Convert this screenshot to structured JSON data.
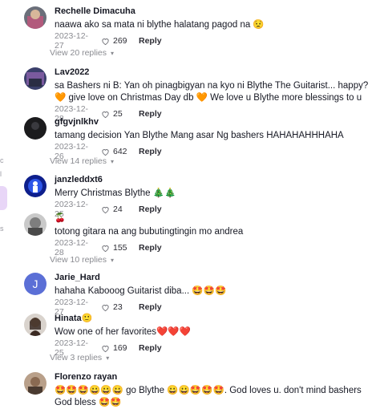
{
  "comments": [
    {
      "username": "Rechelle Dimacuha",
      "text": "naawa ako sa mata ni blythe halatang pagod na 😟",
      "date": "2023-12-27",
      "likes": "269",
      "reply": "Reply"
    },
    {
      "username": "Lav2022",
      "text": "sa Bashers ni B: Yan oh pinagbigyan na kyo ni Blythe The Guitarist... happy?🧡 give love on Christmas Day db 🧡 We love u Blythe more blessings to u",
      "date": "2023-12-28",
      "likes": "25",
      "reply": "Reply"
    },
    {
      "username": "gfgvjnlkhv",
      "text": "tamang decision Yan Blythe Mang asar Ng bashers HAHAHAHHHAHA",
      "date": "2023-12-26",
      "likes": "642",
      "reply": "Reply"
    },
    {
      "username": "janzleddxt6",
      "text": "Merry Christmas Blythe 🎄🎄",
      "date": "2023-12-25",
      "likes": "24",
      "reply": "Reply"
    },
    {
      "username": "🍒",
      "text": "totong gitara na ang bubutingtingin mo andrea",
      "date": "2023-12-28",
      "likes": "155",
      "reply": "Reply"
    },
    {
      "username": "Jarie_Hard",
      "avatar_letter": "J",
      "text": "hahaha Kabooog Guitarist diba... 🤩🤩🤩",
      "date": "2023-12-27",
      "likes": "23",
      "reply": "Reply"
    },
    {
      "username": "Hinata🙂",
      "text": "Wow one of her favorites❤️❤️❤️",
      "date": "2023-12-25",
      "likes": "169",
      "reply": "Reply"
    },
    {
      "username": "Florenzo rayan",
      "text": "🤩🤩🤩😀😀😀 go Blythe 😀😀🤩🤩🤩. God loves u. don't mind bashers God bless 🤩🤩"
    }
  ],
  "view_replies": [
    "View 20 replies",
    "View 14 replies",
    "View 10 replies",
    "View 3 replies"
  ],
  "icons": {
    "like": "heart-outline-icon",
    "chevron": "chevron-down-icon"
  },
  "colors": {
    "text": "#161823",
    "muted": "#8a8b91",
    "avatar_j": "#5b6fd6"
  }
}
